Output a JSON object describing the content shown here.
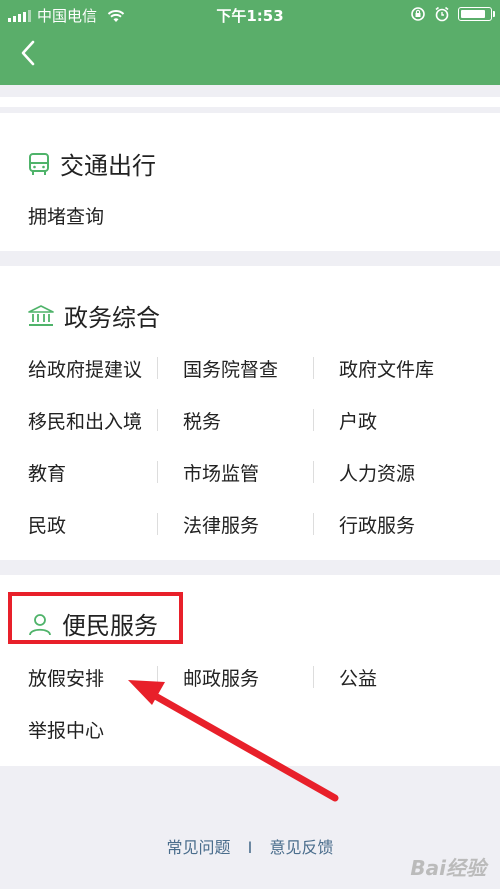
{
  "status_bar": {
    "carrier": "中国电信",
    "time": "下午1:53",
    "battery_level": 0.9
  },
  "nav": {
    "back_icon": "chevron-left-icon"
  },
  "sections": {
    "transport": {
      "title": "交通出行",
      "icon": "bus-icon",
      "items": [
        "拥堵查询"
      ]
    },
    "government": {
      "title": "政务综合",
      "icon": "government-building-icon",
      "items": [
        "给政府提建议",
        "国务院督查",
        "政府文件库",
        "移民和出入境",
        "税务",
        "户政",
        "教育",
        "市场监管",
        "人力资源",
        "民政",
        "法律服务",
        "行政服务"
      ]
    },
    "convenience": {
      "title": "便民服务",
      "icon": "person-icon",
      "items": [
        "放假安排",
        "邮政服务",
        "公益",
        "举报中心"
      ]
    }
  },
  "footer": {
    "faq": "常见问题",
    "divider": "I",
    "feedback": "意见反馈"
  },
  "watermark": "Bai经验",
  "colors": {
    "header": "#5aae6a",
    "accent": "#4fb36a",
    "annotation": "#e8202a",
    "link": "#4a6d8c"
  }
}
